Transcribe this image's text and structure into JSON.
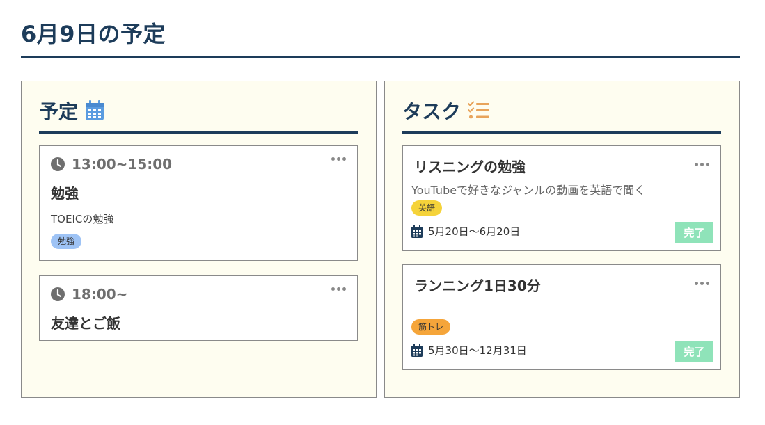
{
  "page": {
    "title": "6月9日の予定"
  },
  "colors": {
    "navy": "#1d3c5a",
    "panel_bg": "#fefdf0",
    "tag_study": "#9ec3f5",
    "tag_english": "#f5d33a",
    "tag_training": "#f5a53a",
    "done_button": "#8fe3b9",
    "calendar_icon_blue": "#5b9ce0",
    "tasklist_icon_orange": "#e8a45b"
  },
  "schedule": {
    "title": "予定",
    "icon": "calendar-icon",
    "events": [
      {
        "time": "13:00~15:00",
        "title": "勉強",
        "description": "TOEICの勉強",
        "tag": "勉強"
      },
      {
        "time": "18:00~",
        "title": "友達とご飯"
      }
    ]
  },
  "tasks": {
    "title": "タスク",
    "icon": "task-list-icon",
    "items": [
      {
        "title": "リスニングの勉強",
        "description": "YouTubeで好きなジャンルの動画を英語で聞く",
        "tag": "英語",
        "period": "5月20日〜6月20日",
        "done_label": "完了"
      },
      {
        "title": "ランニング1日30分",
        "tag": "筋トレ",
        "period": "5月30日〜12月31日",
        "done_label": "完了"
      }
    ]
  }
}
